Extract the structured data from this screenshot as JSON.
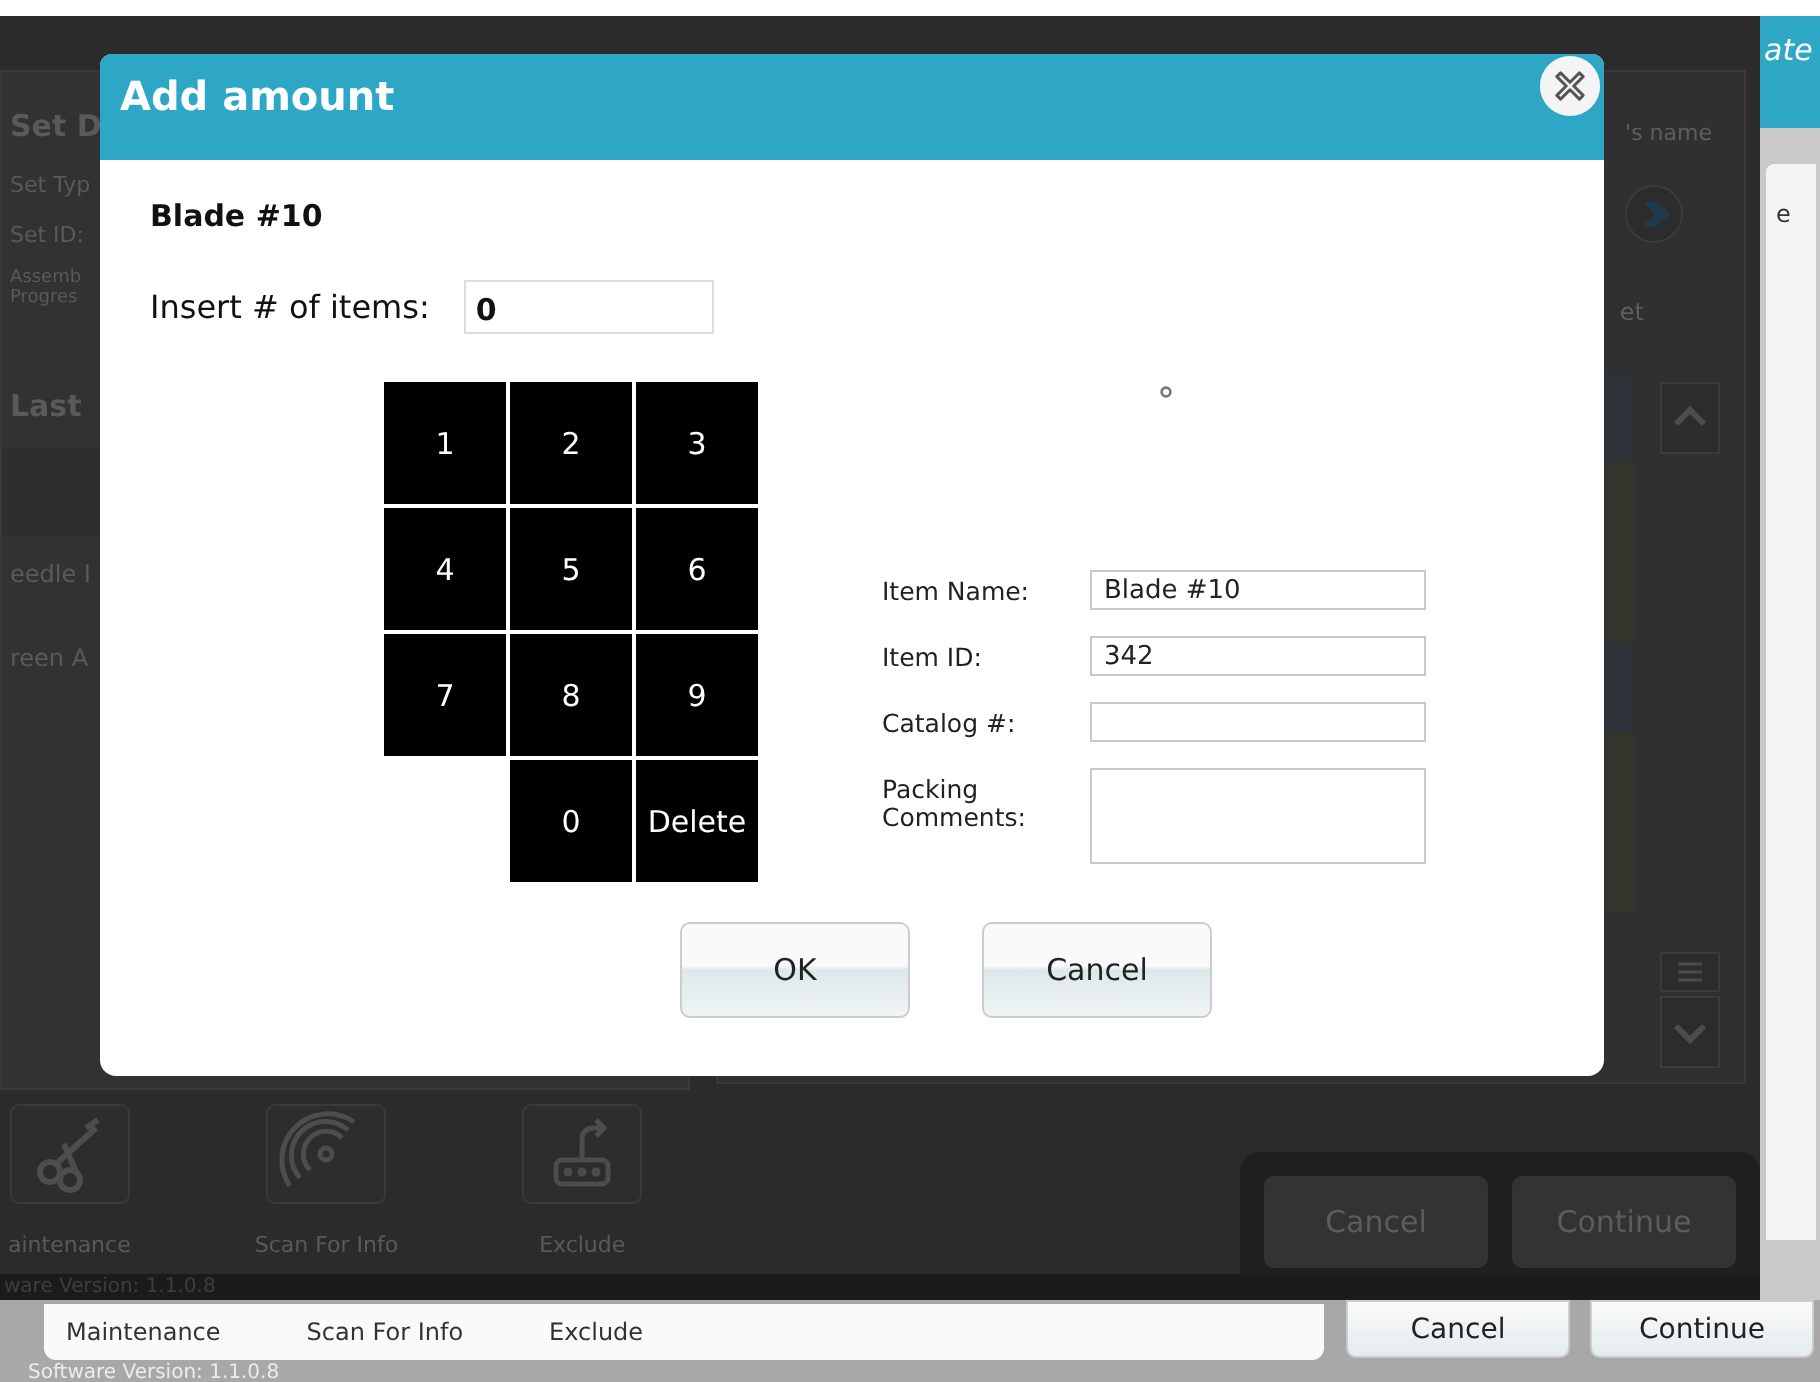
{
  "back_app": {
    "logo_text": "ate",
    "side_text": "e",
    "toolbar": [
      "Maintenance",
      "Scan For Info",
      "Exclude"
    ],
    "buttons": [
      "Cancel",
      "Continue"
    ],
    "version": "Software Version: 1.1.0.8"
  },
  "dimmed_app": {
    "details_title": "Set D",
    "detail_lines": [
      "Set Typ",
      "Set ID:"
    ],
    "progress_lines": [
      "Assemb",
      "Progres"
    ],
    "last_title": "Last",
    "list_items": [
      "eedle I",
      "reen A"
    ],
    "name_header": "'s name",
    "column_header": "et",
    "toolbar": [
      {
        "label": "aintenance",
        "kind": "tools"
      },
      {
        "label": "Scan For Info",
        "kind": "scan"
      },
      {
        "label": "Exclude",
        "kind": "exclude"
      }
    ],
    "buttons": [
      "Cancel",
      "Continue"
    ],
    "version": "ware Version: 1.1.0.8"
  },
  "dialog": {
    "title": "Add amount",
    "item_title": "Blade #10",
    "quantity": {
      "label": "Insert # of items:",
      "value": "0"
    },
    "keypad": [
      "1",
      "2",
      "3",
      "4",
      "5",
      "6",
      "7",
      "8",
      "9",
      "0",
      "Delete"
    ],
    "fields": [
      {
        "label": "Item Name:",
        "value": "Blade #10",
        "kind": "line"
      },
      {
        "label": "Item ID:",
        "value": "342",
        "kind": "line"
      },
      {
        "label": "Catalog #:",
        "kind": "line"
      },
      {
        "label": "Packing Comments:",
        "kind": "multiline"
      }
    ],
    "buttons": [
      "OK",
      "Cancel"
    ]
  }
}
